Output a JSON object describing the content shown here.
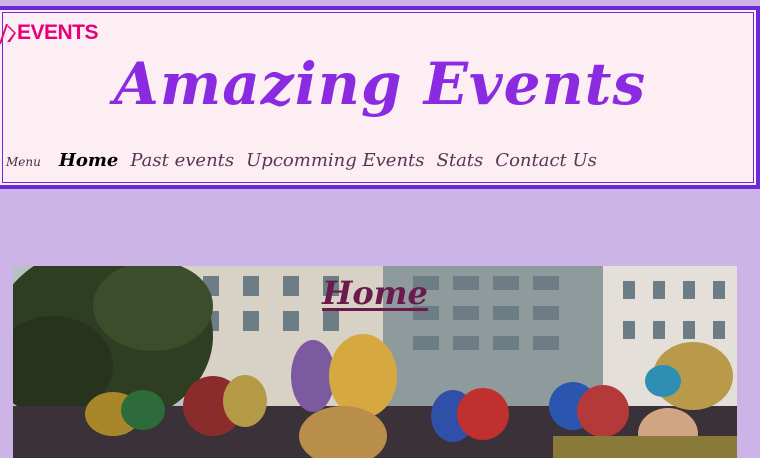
{
  "brand": {
    "logo_text": "EVENTS",
    "logo_color": "#e6007a"
  },
  "header": {
    "title": "Amazing Events",
    "title_color": "#8a2be2",
    "border_color": "#6d28d9"
  },
  "nav": {
    "menu_label": "Menu",
    "items": [
      {
        "label": "Home",
        "active": true
      },
      {
        "label": "Past events",
        "active": false
      },
      {
        "label": "Upcomming Events",
        "active": false
      },
      {
        "label": "Stats",
        "active": false
      },
      {
        "label": "Contact Us",
        "active": false
      }
    ]
  },
  "hero": {
    "title": "Home"
  },
  "colors": {
    "page_background": "#cdb4e6",
    "header_background": "#fdeef3"
  }
}
